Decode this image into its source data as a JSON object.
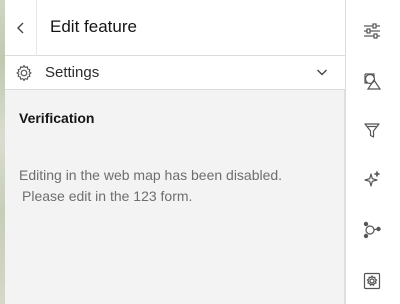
{
  "header": {
    "title": "Edit feature",
    "back_icon": "chevron-left-icon"
  },
  "settings": {
    "label": "Settings",
    "icon": "gear-icon",
    "toggle_icon": "chevron-down-icon"
  },
  "section": {
    "title": "Verification"
  },
  "message": {
    "line1": "Editing in the web map has been disabled.",
    "line2": "Please edit in the 123 form."
  },
  "rail": {
    "items": [
      {
        "icon": "sliders-icon"
      },
      {
        "icon": "shapes-icon"
      },
      {
        "icon": "filter-icon"
      },
      {
        "icon": "sparkle-icon"
      },
      {
        "icon": "nodes-icon"
      },
      {
        "icon": "gear-badge-icon"
      }
    ]
  }
}
